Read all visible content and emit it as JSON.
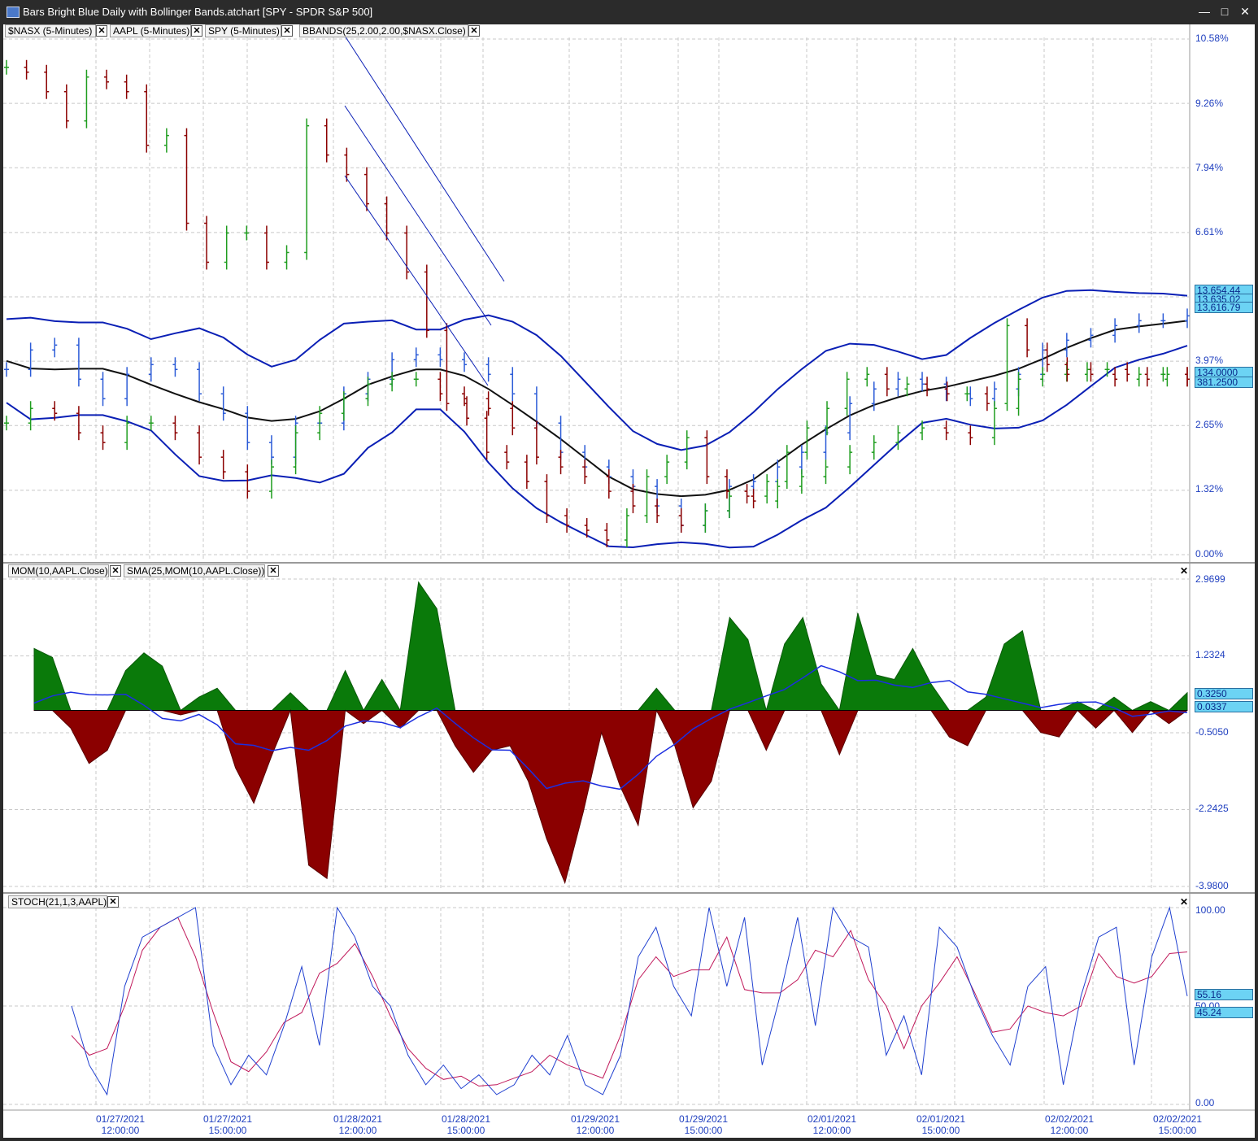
{
  "window": {
    "title": "Bars Bright Blue Daily with Bollinger Bands.atchart [SPY - SPDR S&P 500]",
    "minimize": "—",
    "maximize": "□",
    "close": "✕"
  },
  "price_pane": {
    "tabs": [
      "$NASX (5-Minutes)",
      "AAPL (5-Minutes)",
      "SPY (5-Minutes)",
      "BBANDS(25,2.00,2.00,$NASX.Close)"
    ],
    "y_labels": [
      "10.58%",
      "9.26%",
      "7.94%",
      "6.61%",
      "3.97%",
      "2.65%",
      "1.32%",
      "0.00%"
    ],
    "badges": [
      "13,654.44",
      "13,635.02",
      "13,616.79",
      "134.0000",
      "381.2500"
    ]
  },
  "mom_pane": {
    "tabs": [
      "MOM(10,AAPL.Close)",
      "SMA(25,MOM(10,AAPL.Close))"
    ],
    "y_labels": [
      "2.9699",
      "1.2324",
      "-0.5050",
      "-2.2425",
      "-3.9800"
    ],
    "badges": [
      "0.3250",
      "0.0337"
    ]
  },
  "stoch_pane": {
    "tabs": [
      "STOCH(21,1,3,AAPL)"
    ],
    "y_labels": [
      "100.00",
      "50.00",
      "0.00"
    ],
    "badges": [
      "55.16",
      "45.24"
    ]
  },
  "x_axis": {
    "labels": [
      {
        "date": "01/27/2021",
        "time": "12:00:00"
      },
      {
        "date": "01/27/2021",
        "time": "15:00:00"
      },
      {
        "date": "01/28/2021",
        "time": "12:00:00"
      },
      {
        "date": "01/28/2021",
        "time": "15:00:00"
      },
      {
        "date": "01/29/2021",
        "time": "12:00:00"
      },
      {
        "date": "01/29/2021",
        "time": "15:00:00"
      },
      {
        "date": "02/01/2021",
        "time": "12:00:00"
      },
      {
        "date": "02/01/2021",
        "time": "15:00:00"
      },
      {
        "date": "02/02/2021",
        "time": "12:00:00"
      },
      {
        "date": "02/02/2021",
        "time": "15:00:00"
      }
    ]
  },
  "colors": {
    "bull": "#1f9d1f",
    "bear": "#8b0000",
    "nasx": "#2b5bd7",
    "band": "#0a1fb5",
    "mid": "#111111",
    "mom_pos": "#0a7a0a",
    "mom_neg": "#8b0000",
    "sma": "#1c2ee0",
    "stoch_k": "#2040d0",
    "stoch_d": "#c0185a",
    "grid": "#c8c8c8",
    "axis_text": "#1f3fbf",
    "badge": "#6cd3f4"
  },
  "chart_data": [
    {
      "type": "bar",
      "description_series": [
        "$NASX",
        "AAPL",
        "SPY"
      ],
      "overlays": [
        "BBANDS(25,2.00,2.00,$NASX.Close)"
      ],
      "y_unit": "percent change",
      "ylim": [
        0.0,
        10.58
      ],
      "ticks": [
        10.58,
        9.26,
        7.94,
        6.61,
        3.97,
        2.65,
        1.32,
        0.0
      ],
      "last_values": {
        "bb_upper": 13654.44,
        "bb_mid": 13635.02,
        "bb_lower": 13616.79,
        "aapl": 134.0,
        "spy": 381.25
      },
      "aapl_pct": [
        10.0,
        9.9,
        9.5,
        8.9,
        9.8,
        9.7,
        9.5,
        8.4,
        8.6,
        6.8,
        6.0,
        6.6,
        6.6,
        6.0,
        6.2,
        8.8,
        8.2,
        7.8,
        7.2,
        6.6,
        5.8,
        4.6,
        3.1,
        2.8,
        2.1,
        1.9,
        1.5,
        0.8,
        0.6,
        0.5,
        0.3,
        0.8,
        1.6,
        1.9,
        2.4,
        1.6,
        1.3,
        1.2,
        1.5,
        2.1,
        2.6,
        3.0,
        3.6,
        3.7,
        3.4,
        3.5,
        3.4,
        3.3,
        3.3,
        3.1,
        4.7,
        4.2,
        3.9,
        3.7,
        3.8,
        3.8,
        3.7,
        3.6,
        3.7,
        3.6
      ],
      "nasx_pct": [
        3.8,
        4.2,
        4.3,
        3.6,
        3.2,
        3.7,
        3.9,
        3.8,
        3.3,
        2.9,
        2.3,
        2.0,
        2.7,
        2.7,
        3.3,
        3.6,
        4.0,
        4.1,
        4.0,
        3.9,
        3.7,
        3.3,
        2.7,
        2.1,
        1.8,
        1.6,
        1.4,
        1.0,
        0.6,
        0.9,
        1.4,
        1.5,
        1.8,
        2.1,
        2.5,
        3.1,
        3.4,
        3.6,
        3.5,
        3.3,
        3.2,
        3.4,
        3.7,
        4.2,
        4.4,
        4.5,
        4.7,
        4.8,
        4.8,
        4.9
      ],
      "spy_pct": [
        2.7,
        3.0,
        2.9,
        2.5,
        2.3,
        2.7,
        2.7,
        2.5,
        2.0,
        1.7,
        1.3,
        1.8,
        2.5,
        2.9,
        3.2,
        3.5,
        3.6,
        3.6,
        3.3,
        3.2,
        3.0,
        2.6,
        2.0,
        1.8,
        1.6,
        1.3,
        1.0,
        0.8,
        0.6,
        0.9,
        1.2,
        1.1,
        1.4,
        1.6,
        1.8,
        2.1,
        2.3,
        2.5,
        2.6,
        2.5,
        2.4,
        3.0,
        3.6,
        3.7,
        3.8,
        3.7,
        3.6,
        3.7,
        3.7,
        3.6
      ]
    },
    {
      "type": "area",
      "series": [
        "MOM(10,AAPL.Close)",
        "SMA(25,MOM(10,AAPL.Close))"
      ],
      "ylim": [
        -3.98,
        2.9699
      ],
      "ticks": [
        2.9699,
        1.2324,
        -0.505,
        -2.2425,
        -3.98
      ],
      "last_values": {
        "mom": 0.325,
        "sma": 0.0337
      },
      "mom": [
        1.4,
        1.2,
        -0.4,
        -1.2,
        -0.9,
        0.9,
        1.3,
        1.0,
        -0.1,
        0.3,
        0.5,
        -1.3,
        -2.1,
        -1.0,
        0.4,
        -3.5,
        -3.8,
        0.9,
        -0.3,
        0.7,
        -0.4,
        2.9,
        2.3,
        -0.8,
        -1.4,
        -0.9,
        -0.8,
        -1.6,
        -2.9,
        -3.9,
        -2.3,
        -0.5,
        -1.7,
        -2.6,
        0.5,
        -0.8,
        -2.2,
        -1.6,
        2.1,
        1.6,
        -0.9,
        1.5,
        2.1,
        0.6,
        -1.0,
        2.2,
        0.8,
        0.7,
        1.4,
        0.6,
        -0.6,
        -0.8,
        0.3,
        1.5,
        1.8,
        -0.5,
        -0.6,
        0.2,
        -0.4,
        0.3,
        -0.5,
        0.2,
        -0.3,
        0.4
      ]
    },
    {
      "type": "line",
      "series": [
        "STOCH(21,1,3,AAPL) %K",
        "%D"
      ],
      "ylim": [
        0.0,
        100.0
      ],
      "ticks": [
        100.0,
        50.0,
        0.0
      ],
      "last_values": {
        "k": 55.16,
        "d": 45.24
      },
      "k": [
        50,
        20,
        5,
        60,
        85,
        90,
        95,
        100,
        30,
        10,
        25,
        15,
        40,
        70,
        30,
        100,
        85,
        60,
        50,
        25,
        10,
        20,
        8,
        15,
        5,
        10,
        25,
        15,
        35,
        10,
        5,
        25,
        75,
        90,
        60,
        45,
        100,
        60,
        95,
        20,
        55,
        95,
        40,
        100,
        85,
        80,
        25,
        45,
        15,
        90,
        80,
        55,
        35,
        20,
        60,
        70,
        10,
        55,
        85,
        90,
        20,
        75,
        100,
        55
      ]
    }
  ]
}
